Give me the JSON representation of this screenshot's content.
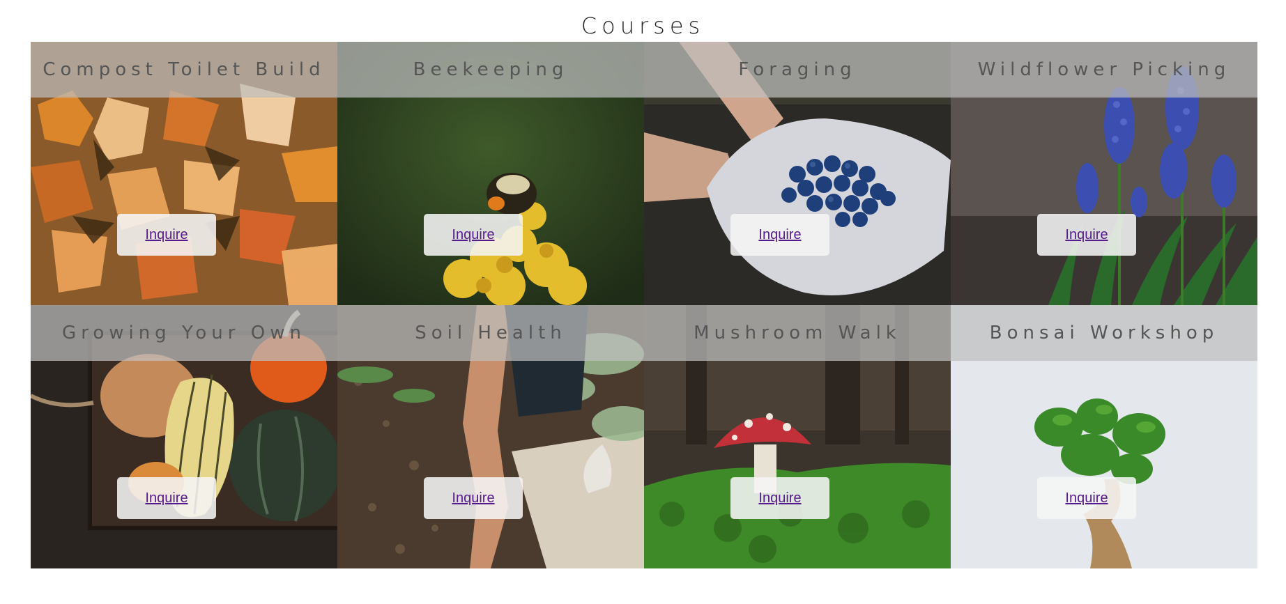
{
  "page": {
    "title": "Courses"
  },
  "courses": [
    {
      "title": "Compost Toilet Build",
      "link": "Inquire"
    },
    {
      "title": "Beekeeping",
      "link": "Inquire"
    },
    {
      "title": "Foraging",
      "link": "Inquire"
    },
    {
      "title": "Wildflower Picking",
      "link": "Inquire"
    },
    {
      "title": "Growing Your Own",
      "link": "Inquire"
    },
    {
      "title": "Soil Health",
      "link": "Inquire"
    },
    {
      "title": "Mushroom Walk",
      "link": "Inquire"
    },
    {
      "title": "Bonsai Workshop",
      "link": "Inquire"
    }
  ],
  "colors": {
    "header_overlay": "#bebebe",
    "title_text": "#555555",
    "link": "#551a8b"
  }
}
